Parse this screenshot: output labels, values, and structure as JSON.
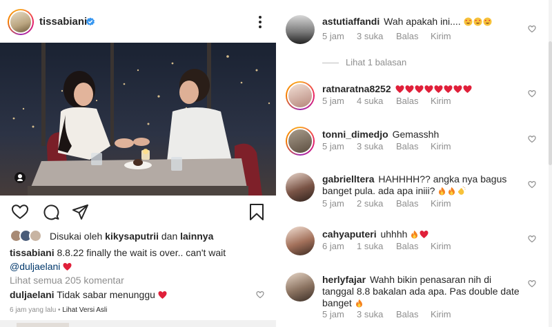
{
  "post": {
    "username": "tissabiani",
    "likes_prefix": "Disukai oleh",
    "likes_user": "kikysaputrii",
    "likes_and": "dan",
    "likes_others": "lainnya",
    "caption_user": "tissabiani",
    "caption_text": "8.8.22 finally the wait is over.. can't wait",
    "caption_mention": "@duljaelani",
    "view_all": "Lihat semua 205 komentar",
    "comment_user": "duljaelani",
    "comment_text": "Tidak sabar menunggu",
    "time": "6 jam yang lalu",
    "separator": "•",
    "original_link": "Lihat Versi Asli"
  },
  "comments": [
    {
      "user": "astutiaffandi",
      "text": "Wah apakah ini....",
      "emojis": [
        "heart-eyes",
        "heart-eyes",
        "heart-eyes"
      ],
      "time": "5 jam",
      "likes": "3 suka",
      "reply": "Balas",
      "send": "Kirim"
    },
    {
      "user": "ratnaratna8252",
      "text": "",
      "emojis": [
        "heart",
        "heart",
        "heart",
        "heart",
        "heart",
        "heart",
        "heart",
        "heart"
      ],
      "time": "5 jam",
      "likes": "4 suka",
      "reply": "Balas",
      "send": "Kirim"
    },
    {
      "user": "tonni_dimedjo",
      "text": "Gemasshh",
      "emojis": [],
      "time": "5 jam",
      "likes": "3 suka",
      "reply": "Balas",
      "send": "Kirim"
    },
    {
      "user": "gabrielltera",
      "text": "HAHHHH?? angka nya bagus banget pula. ada apa iniii?",
      "emojis": [
        "fire",
        "fire",
        "clap"
      ],
      "time": "5 jam",
      "likes": "2 suka",
      "reply": "Balas",
      "send": "Kirim"
    },
    {
      "user": "cahyaputeri",
      "text": "uhhhh",
      "emojis": [
        "fire",
        "heart"
      ],
      "time": "6 jam",
      "likes": "1 suka",
      "reply": "Balas",
      "send": "Kirim"
    },
    {
      "user": "herlyfajar",
      "text": "Wahh bikin penasaran nih di tanggal 8.8 bakalan ada apa. Pas double date banget",
      "emojis": [
        "fire"
      ],
      "time": "5 jam",
      "likes": "3 suka",
      "reply": "Balas",
      "send": "Kirim"
    }
  ],
  "view_replies": "Lihat 1 balasan",
  "icons": [
    "verified-icon",
    "more-options-icon",
    "tag-people-icon",
    "like-icon",
    "comment-icon",
    "share-icon",
    "save-icon",
    "small-heart-icon"
  ],
  "colors": {
    "accent_link": "#00376b",
    "muted": "#8e8e8e",
    "heart": "#ed4956",
    "verified": "#3897f0"
  }
}
